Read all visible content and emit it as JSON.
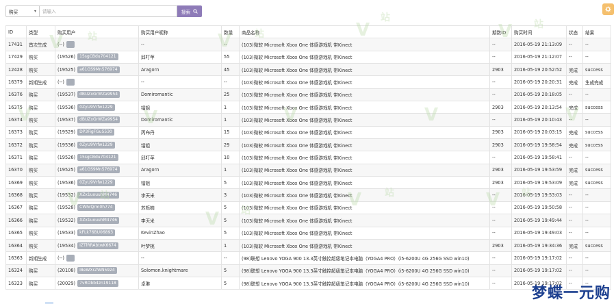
{
  "search": {
    "field_select": "购买",
    "placeholder": "请输入",
    "button_label": "搜索"
  },
  "columns": [
    "ID",
    "类型",
    "购买用户",
    "购买用户昵称",
    "数量",
    "商品名称",
    "期数ID",
    "购买时间",
    "状态",
    "结果"
  ],
  "rows": [
    {
      "id": "17431",
      "type": "首次生成",
      "user_id": "(--)",
      "user_tag": "",
      "nick": "--",
      "qty": "--",
      "product": "(103)微软 Microsoft Xbox One 体感游戏机 带Kinect",
      "period": "--",
      "time": "2016-05-19 21:13:09",
      "status": "--",
      "result": "--"
    },
    {
      "id": "17429",
      "type": "购买",
      "user_id": "(19526)",
      "user_tag": "15sgCBdu704121",
      "nick": "邱叮苹",
      "qty": "55",
      "product": "(103)微软 Microsoft Xbox One 体感游戏机 带Kinect",
      "period": "--",
      "time": "2016-05-19 21:12:07",
      "status": "--",
      "result": "--"
    },
    {
      "id": "12428",
      "type": "购买",
      "user_id": "(19525)",
      "user_tag": "a61GS9Mn576974",
      "nick": "Aragorn",
      "qty": "45",
      "product": "(103)微软 Microsoft Xbox One 体感游戏机 带Kinect",
      "period": "2903",
      "time": "2016-05-19 20:52:52",
      "status": "完成",
      "result": "success"
    },
    {
      "id": "16379",
      "type": "新期生成",
      "user_id": "(--)",
      "user_tag": "",
      "nick": "--",
      "qty": "--",
      "product": "(103)微软 Microsoft Xbox One 体感游戏机 带Kinect",
      "period": "--",
      "time": "2016-05-19 20:20:31",
      "status": "完成",
      "result": "生成完成"
    },
    {
      "id": "16376",
      "type": "购买",
      "user_id": "(19537)",
      "user_tag": "dBUZxGrWZa9954",
      "nick": "Domiromantic",
      "qty": "25",
      "product": "(103)微软 Microsoft Xbox One 体感游戏机 带Kinect",
      "period": "--",
      "time": "2016-05-19 20:18:05",
      "status": "--",
      "result": "--"
    },
    {
      "id": "16375",
      "type": "购买",
      "user_id": "(19536)",
      "user_tag": "0ZyU9Vrfw1229",
      "nick": "镭姐",
      "qty": "1",
      "product": "(103)微软 Microsoft Xbox One 体感游戏机 带Kinect",
      "period": "2903",
      "time": "2016-05-19 20:13:54",
      "status": "完成",
      "result": "success"
    },
    {
      "id": "16374",
      "type": "购买",
      "user_id": "(19537)",
      "user_tag": "dBUZxGrWZa9954",
      "nick": "Domiromantic",
      "qty": "1",
      "product": "(103)微软 Microsoft Xbox One 体感游戏机 带Kinect",
      "period": "--",
      "time": "2016-05-19 20:10:43",
      "status": "--",
      "result": "--"
    },
    {
      "id": "16373",
      "type": "购买",
      "user_id": "(19529)",
      "user_tag": "DP3FigFGu5530",
      "nick": "丙布丹",
      "qty": "15",
      "product": "(103)微软 Microsoft Xbox One 体感游戏机 带Kinect",
      "period": "2903",
      "time": "2016-05-19 20:03:15",
      "status": "完成",
      "result": "success"
    },
    {
      "id": "16372",
      "type": "购买",
      "user_id": "(19536)",
      "user_tag": "0ZyU9Vrfw1229",
      "nick": "镭姐",
      "qty": "29",
      "product": "(103)微软 Microsoft Xbox One 体感游戏机 带Kinect",
      "period": "2903",
      "time": "2016-05-19 19:58:54",
      "status": "完成",
      "result": "success"
    },
    {
      "id": "16371",
      "type": "购买",
      "user_id": "(19526)",
      "user_tag": "15sgCBdu704121",
      "nick": "邱叮苹",
      "qty": "10",
      "product": "(103)微软 Microsoft Xbox One 体感游戏机 带Kinect",
      "period": "--",
      "time": "2016-05-19 19:58:41",
      "status": "--",
      "result": "--"
    },
    {
      "id": "16370",
      "type": "购买",
      "user_id": "(19525)",
      "user_tag": "a61GS9Mn576974",
      "nick": "Aragorn",
      "qty": "1",
      "product": "(103)微软 Microsoft Xbox One 体感游戏机 带Kinect",
      "period": "2903",
      "time": "2016-05-19 19:53:59",
      "status": "完成",
      "result": "success"
    },
    {
      "id": "16369",
      "type": "购买",
      "user_id": "(19536)",
      "user_tag": "0ZyU9Vrfw1229",
      "nick": "镭姐",
      "qty": "5",
      "product": "(103)微软 Microsoft Xbox One 体感游戏机 带Kinect",
      "period": "2903",
      "time": "2016-05-19 19:53:09",
      "status": "完成",
      "result": "success"
    },
    {
      "id": "16368",
      "type": "购买",
      "user_id": "(19532)",
      "user_tag": "XZx1uouuhM4746",
      "nick": "李天米",
      "qty": "3",
      "product": "(103)微软 Microsoft Xbox One 体感游戏机 带Kinect",
      "period": "--",
      "time": "2016-05-19 19:53:03",
      "status": "--",
      "result": "--"
    },
    {
      "id": "16367",
      "type": "购买",
      "user_id": "(19528)",
      "user_tag": "CWhrQrm0h774",
      "nick": "苏栎楠",
      "qty": "5",
      "product": "(103)微软 Microsoft Xbox One 体感游戏机 带Kinect",
      "period": "--",
      "time": "2016-05-19 19:50:58",
      "status": "--",
      "result": "--"
    },
    {
      "id": "16366",
      "type": "购买",
      "user_id": "(19532)",
      "user_tag": "XZx1uouuhM4746",
      "nick": "李天米",
      "qty": "5",
      "product": "(103)微软 Microsoft Xbox One 体感游戏机 带Kinect",
      "period": "--",
      "time": "2016-05-19 19:49:44",
      "status": "--",
      "result": "--"
    },
    {
      "id": "16365",
      "type": "购买",
      "user_id": "(19533)",
      "user_tag": "kFLk76BU06893",
      "nick": "KevinZhao",
      "qty": "5",
      "product": "(103)微软 Microsoft Xbox One 体感游戏机 带Kinect",
      "period": "--",
      "time": "2016-05-19 19:49:03",
      "status": "--",
      "result": "--"
    },
    {
      "id": "16364",
      "type": "购买",
      "user_id": "(19534)",
      "user_tag": "IZTlRRAbtwK6674",
      "nick": "叶梦桃",
      "qty": "1",
      "product": "(103)微软 Microsoft Xbox One 体感游戏机 带Kinect",
      "period": "2903",
      "time": "2016-05-19 19:34:36",
      "status": "完成",
      "result": "success"
    },
    {
      "id": "16363",
      "type": "新期生成",
      "user_id": "(--)",
      "user_tag": "",
      "nick": "--",
      "qty": "--",
      "product": "(98)联想 Lenovo YOGA 900 13.3英寸触控超级笔记本电脑（YOGA4 PRO）(i5-6200U 4G 256G SSD win10)",
      "period": "--",
      "time": "2016-05-19 19:17:02",
      "status": "--",
      "result": "--"
    },
    {
      "id": "16324",
      "type": "购买",
      "user_id": "(20108)",
      "user_tag": "I8eWXrZWN5924",
      "nick": "Solomon.knightmare",
      "qty": "5",
      "product": "(98)联想 Lenovo YOGA 900 13.3英寸触控超级笔记本电脑（YOGA4 PRO）(i5-6200U 4G 256G SSD win10)",
      "period": "--",
      "time": "2016-05-19 19:17:02",
      "status": "--",
      "result": "--"
    },
    {
      "id": "16323",
      "type": "购买",
      "user_id": "(20029)",
      "user_tag": "7vRObb4zn19118",
      "nick": "卓琳",
      "qty": "5",
      "product": "(98)联想 Lenovo YOGA 900 13.3英寸触控超级笔记本电脑（YOGA4 PRO）(i5-6200U 4G 256G SSD win10)",
      "period": "--",
      "time": "2016-05-19 19:17:02",
      "status": "--",
      "result": "--"
    }
  ],
  "watermark_text": "梦蝶一元购",
  "colors": {
    "search_button": "#8e7bb8",
    "corner_button": "#f5c06e",
    "tag": "#a8aeb8",
    "watermark": "#1c3f8f"
  }
}
